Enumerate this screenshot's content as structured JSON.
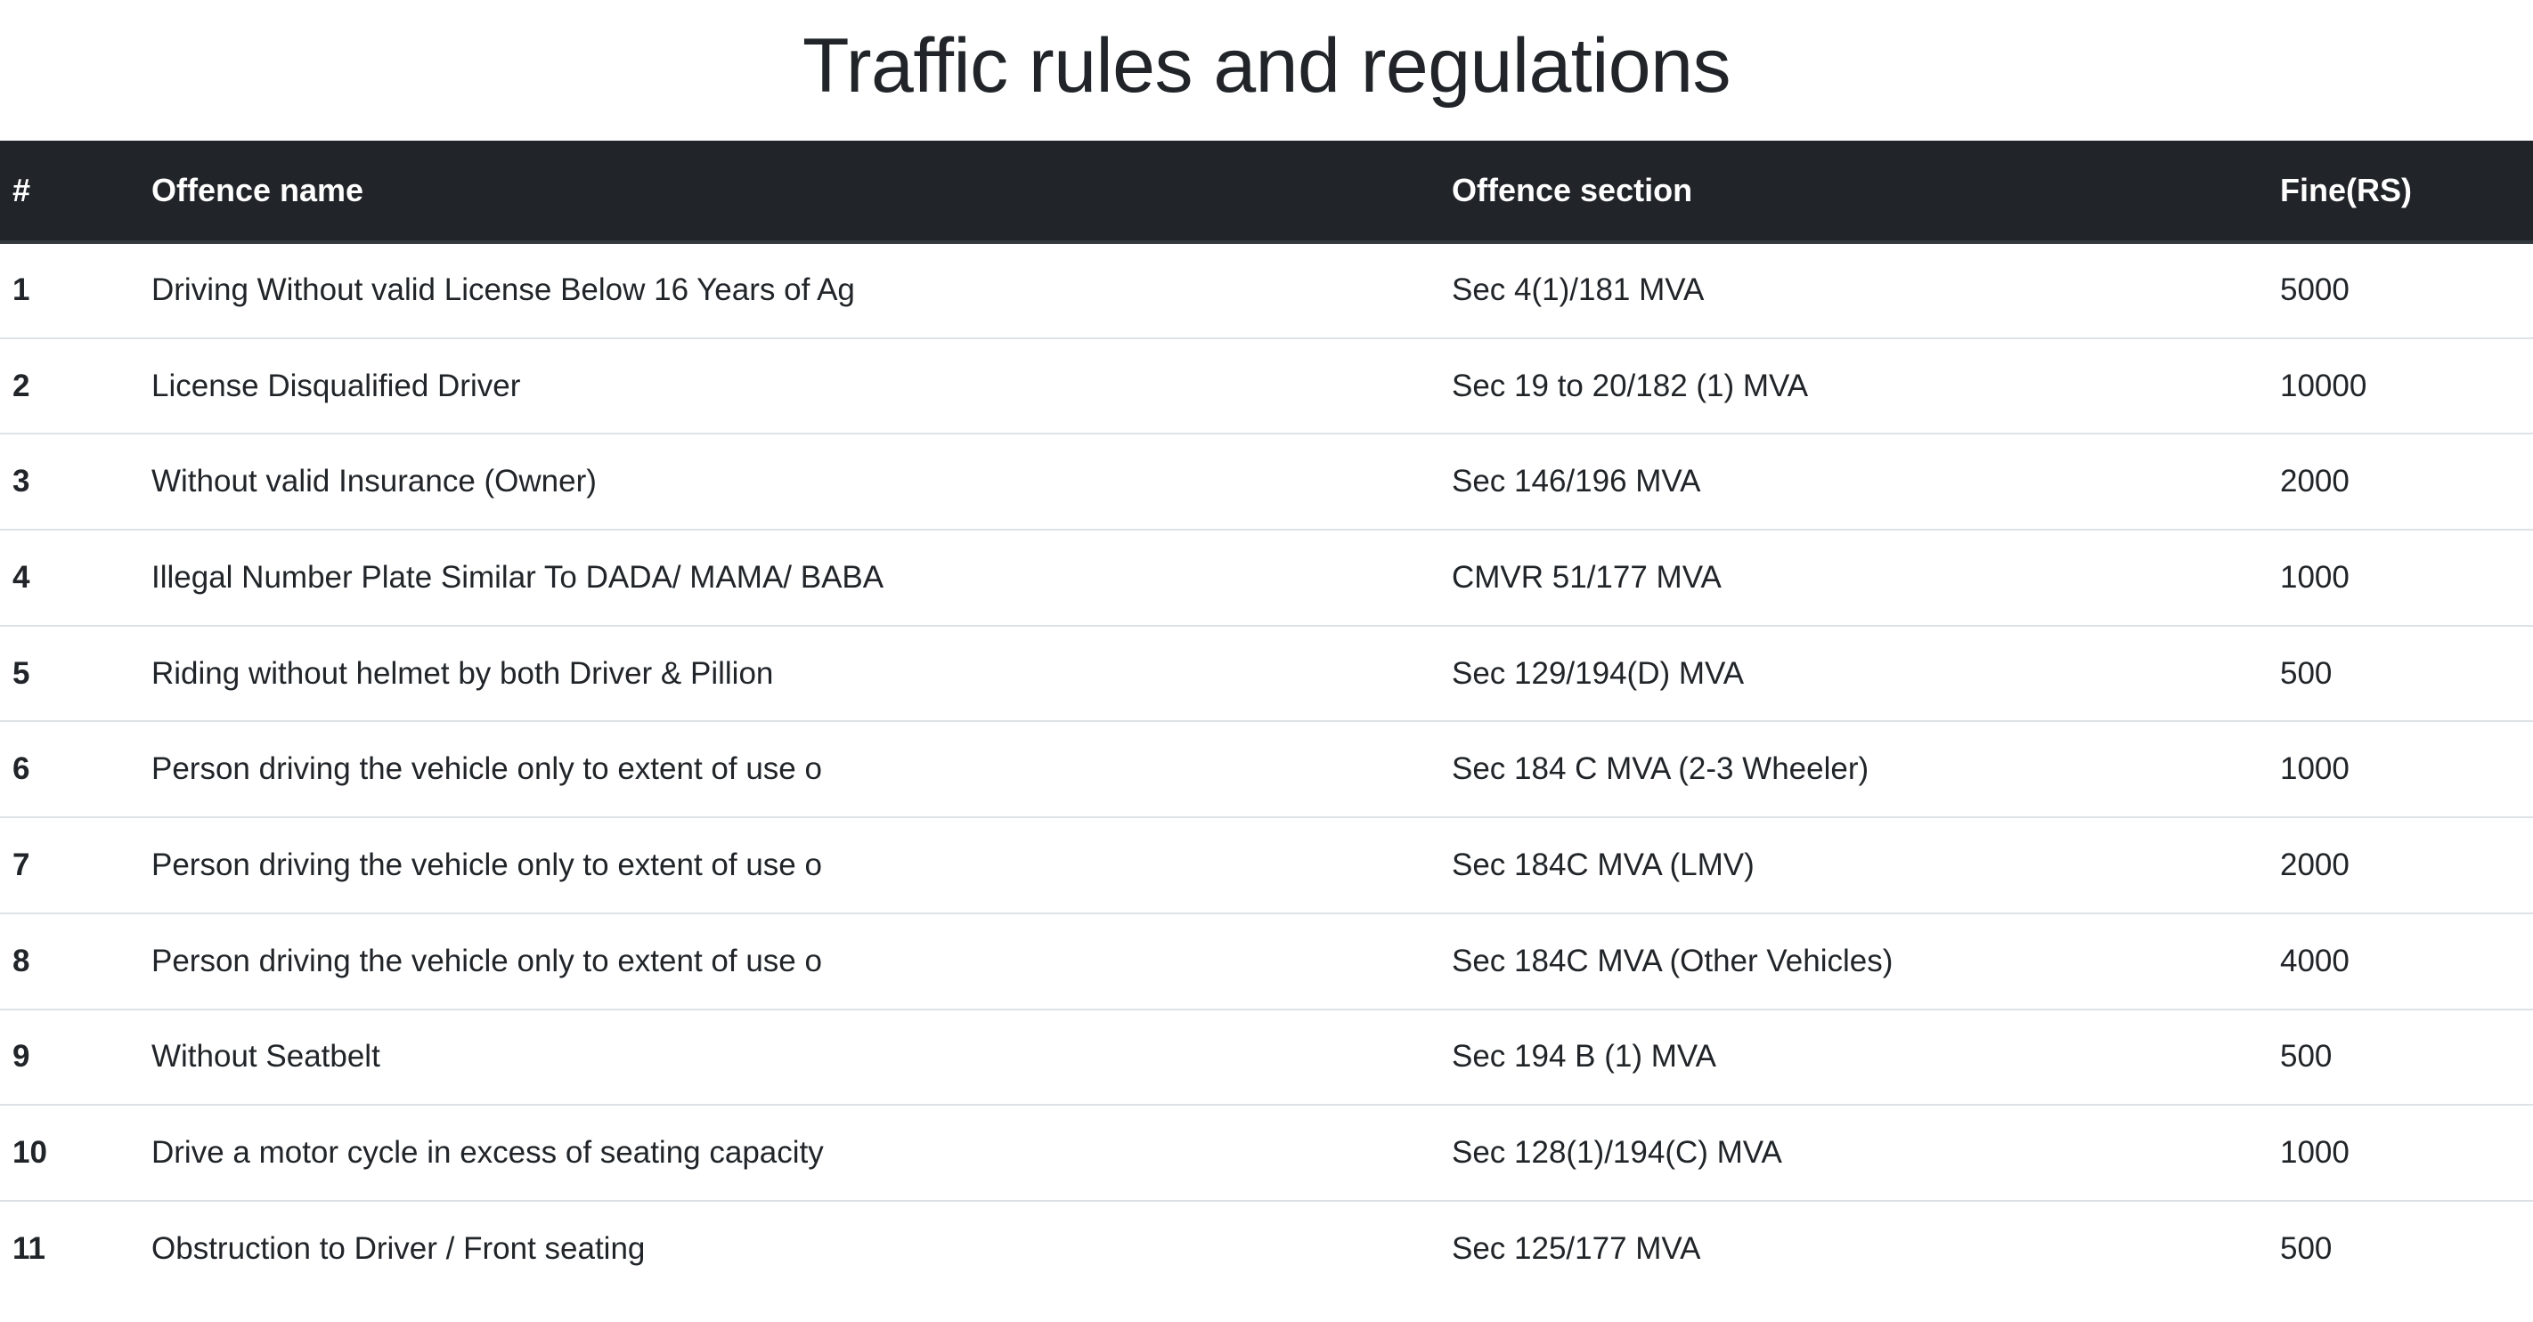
{
  "page": {
    "title": "Traffic rules and regulations"
  },
  "table": {
    "headers": {
      "num": "#",
      "name": "Offence name",
      "section": "Offence section",
      "fine": "Fine(RS)"
    },
    "rows": [
      {
        "num": "1",
        "name": "Driving Without valid License Below 16 Years of Ag",
        "section": "Sec 4(1)/181 MVA",
        "fine": "5000"
      },
      {
        "num": "2",
        "name": "License Disqualified Driver",
        "section": "Sec 19 to 20/182 (1) MVA",
        "fine": "10000"
      },
      {
        "num": "3",
        "name": "Without valid Insurance (Owner)",
        "section": "Sec 146/196 MVA",
        "fine": "2000"
      },
      {
        "num": "4",
        "name": "Illegal Number Plate Similar To DADA/ MAMA/ BABA",
        "section": "CMVR 51/177 MVA",
        "fine": "1000"
      },
      {
        "num": "5",
        "name": "Riding without helmet by both Driver & Pillion",
        "section": "Sec 129/194(D) MVA",
        "fine": "500"
      },
      {
        "num": "6",
        "name": "Person driving the vehicle only to extent of use o",
        "section": "Sec 184 C MVA (2-3 Wheeler)",
        "fine": "1000"
      },
      {
        "num": "7",
        "name": "Person driving the vehicle only to extent of use o",
        "section": "Sec 184C MVA (LMV)",
        "fine": "2000"
      },
      {
        "num": "8",
        "name": "Person driving the vehicle only to extent of use o",
        "section": "Sec 184C MVA (Other Vehicles)",
        "fine": "4000"
      },
      {
        "num": "9",
        "name": "Without Seatbelt",
        "section": "Sec 194 B (1) MVA",
        "fine": "500"
      },
      {
        "num": "10",
        "name": "Drive a motor cycle in excess of seating capacity",
        "section": "Sec 128(1)/194(C) MVA",
        "fine": "1000"
      },
      {
        "num": "11",
        "name": "Obstruction to Driver / Front seating",
        "section": "Sec 125/177 MVA",
        "fine": "500"
      }
    ]
  },
  "colors": {
    "header_bg": "#212529",
    "header_text": "#ffffff",
    "body_text": "#212529",
    "row_border": "#dee2e6"
  }
}
